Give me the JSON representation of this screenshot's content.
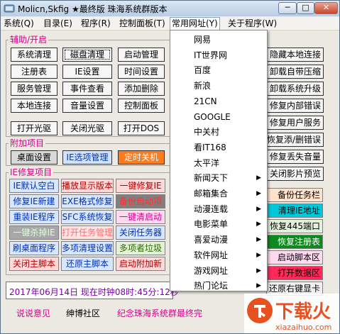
{
  "window": {
    "title": "Molicn,Skfig ★最终版 珠海系统群版本",
    "minimize": "─",
    "maximize": "□",
    "close": "✕"
  },
  "menubar": [
    "系统(Q)",
    "目录(E)",
    "程序(R)",
    "控制面板(T)",
    "常用网址(Y)",
    "关于程序(W)"
  ],
  "groups": {
    "aux": "辅助/开启",
    "extra": "附加项目",
    "ie": "IE修复项目"
  },
  "aux_buttons": [
    "系统清理",
    "磁盘清理",
    "启动管理",
    "注册表",
    "IE设置",
    "时间设置",
    "服务管理",
    "事件查看",
    "添加删除",
    "本地连接",
    "音量设置",
    "控制面板",
    "打开光驱",
    "关闭光驱",
    "打开DOS"
  ],
  "extra_buttons": [
    "桌面设置",
    "IE选项管理",
    "定时关机"
  ],
  "ie_buttons": [
    "IE默认空白",
    "播放显示版本",
    "一键修复IE",
    "修复IE新建",
    "EXE格式修复",
    "备份启动项",
    "重装IE程序",
    "SFC系统恢复",
    "一键清启动",
    "一键杀掉IE",
    "打开任务管理",
    "关闭任务器",
    "刷桌面程序",
    "多项清理设置",
    "多项者垃圾",
    "关闭主脚本",
    "还原主脚本",
    "启动附加新"
  ],
  "right_buttons": [
    "隐藏本地连接",
    "卸载自带压缩",
    "卸载系统升级",
    "修复内部错误",
    "修复用户服务",
    "恢复添/删错误",
    "修复丢失音量",
    "关闭影片预览",
    "备份任务栏",
    "清理IE地址",
    "恢复445端口",
    "恢复注册表",
    "启动脚本区",
    "打开数据区",
    "还原右键显卡"
  ],
  "dropdown": [
    {
      "label": "网易",
      "sub": false
    },
    {
      "label": "IT世界网",
      "sub": false
    },
    {
      "label": "百度",
      "sub": false
    },
    {
      "label": "新浪",
      "sub": false
    },
    {
      "label": "21CN",
      "sub": false
    },
    {
      "label": "GOOGLE",
      "sub": false
    },
    {
      "label": "中关村",
      "sub": false
    },
    {
      "label": "看IT168",
      "sub": false
    },
    {
      "label": "太平洋",
      "sub": false
    },
    {
      "label": "新闻天下",
      "sub": true
    },
    {
      "label": "邮箱集合",
      "sub": true
    },
    {
      "label": "动漫连载",
      "sub": true
    },
    {
      "label": "电影菜单",
      "sub": true
    },
    {
      "label": "喜爱动漫",
      "sub": true
    },
    {
      "label": "软件网址",
      "sub": true
    },
    {
      "label": "游戏网址",
      "sub": true
    },
    {
      "label": "热门论坛",
      "sub": true
    }
  ],
  "submenu_arrow": "▶",
  "datetime": "2017年06月14日  现在时钟08时:45分:12秒",
  "bottom_links": [
    "说说意见",
    "绅博社区",
    "纪念珠海系统群最终完"
  ],
  "watermark": {
    "brand": "下载火",
    "url": "xiazaihuo.com"
  },
  "colors": {
    "accent": "#d4008f",
    "menu_active": "#1e5fa8",
    "orange": "#ff7a1a",
    "watermark": "#e8501f"
  }
}
